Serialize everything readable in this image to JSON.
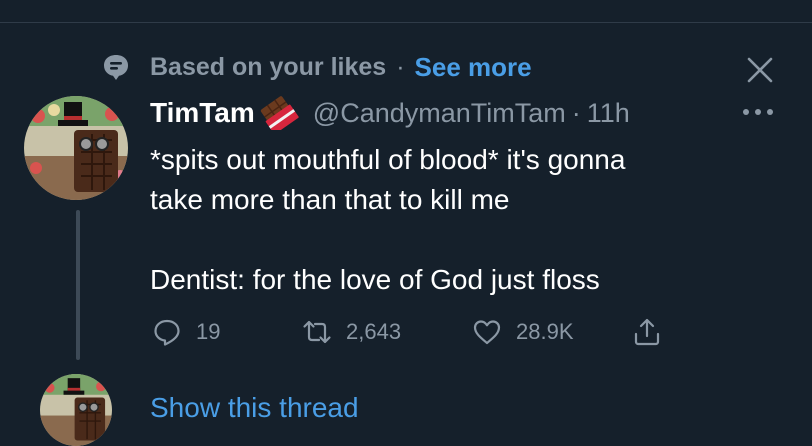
{
  "context": {
    "text": "Based on your likes",
    "dot": "·",
    "see_more": "See more",
    "icon": "speech-bubble-icon"
  },
  "tweet": {
    "display_name": "TimTam",
    "name_emoji": "chocolate-bar-icon",
    "handle": "@CandymanTimTam",
    "dot": "·",
    "time": "11h",
    "lines": [
      "*spits out mouthful of blood* it's gonna",
      "take more than that to kill me",
      "Dentist: for the love of God just floss"
    ],
    "replies": "19",
    "retweets": "2,643",
    "likes": "28.9K"
  },
  "thread": {
    "show_label": "Show this thread"
  },
  "colors": {
    "background": "#15202b",
    "muted": "#8b98a5",
    "accent": "#4a9ee6",
    "text": "#ffffff"
  }
}
